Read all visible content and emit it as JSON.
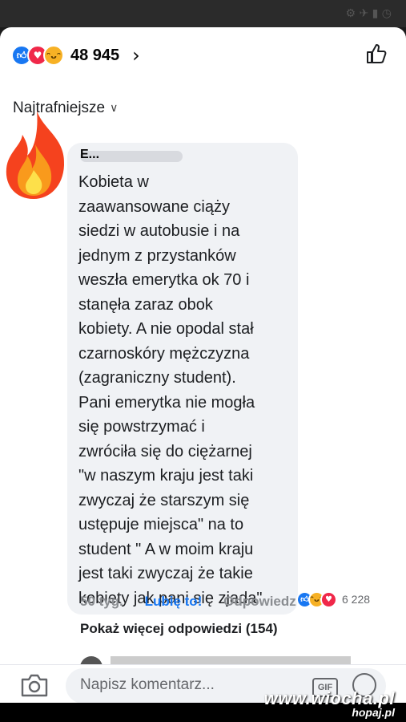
{
  "reactions": {
    "total": "48 945",
    "icons": [
      "like-icon",
      "love-icon",
      "haha-icon"
    ]
  },
  "sort_label": "Najtrafniejsze",
  "comment": {
    "author": "E...",
    "text": "Kobieta w\nzaawansowane ciąży\nsiedzi w autobusie i na\njednym z przystanków\nweszła emerytka ok 70 i\nstanęła zaraz obok\nkobiety. A nie opodal stał\nczarnoskóry  mężczyzna\n(zagraniczny student).\nPani emerytka nie mogła\nsię powstrzymać i\nzwróciła się do ciężarnej\n\"w naszym kraju jest taki\nzwyczaj że starszym się\nustępuje miejsca\" na to\nstudent \" A w moim kraju\njest taki zwyczaj że takie\nkobiety jak pani się zjada\"",
    "reaction_count": "6 228",
    "time": "50 tyg.",
    "like_label": "Lubię to!",
    "reply_label": "Odpowiedz"
  },
  "more_replies": "Pokaż więcej odpowiedzi (154)",
  "composer": {
    "placeholder": "Napisz komentarz...",
    "gif_label": "GIF"
  },
  "watermark": {
    "line1": "www.wiocha.pl",
    "line2": "hopaj.pl"
  },
  "colors": {
    "like_blue": "#1877f2",
    "love_red": "#f02849",
    "haha_yellow": "#f7b125",
    "bubble_bg": "#f0f2f5"
  }
}
